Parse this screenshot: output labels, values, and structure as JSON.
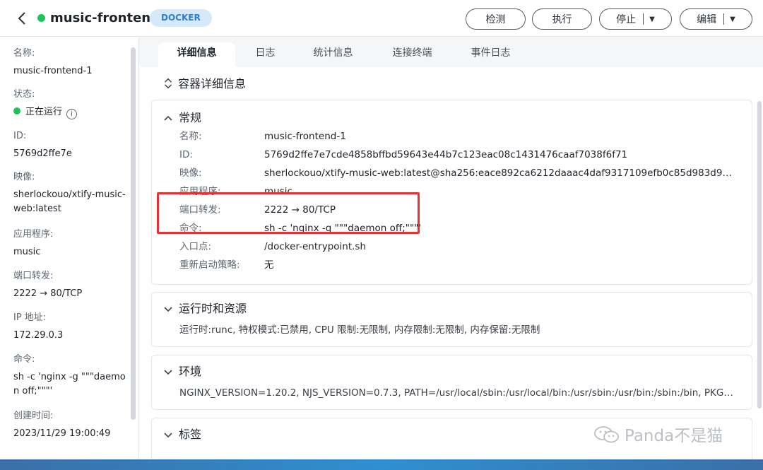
{
  "header": {
    "title": "music-frontend-1",
    "badge": "DOCKER",
    "buttons": {
      "detect": "检测",
      "execute": "执行",
      "stop": "停止",
      "edit": "编辑"
    },
    "status_color": "#1fc25a"
  },
  "sidebar": {
    "name_label": "名称:",
    "name_value": "music-frontend-1",
    "status_label": "状态:",
    "status_value": "正在运行",
    "id_label": "ID:",
    "id_value": "5769d2ffe7e",
    "image_label": "映像:",
    "image_value": "sherlockouo/xtify-music-web:latest",
    "app_label": "应用程序:",
    "app_value": "music",
    "port_label": "端口转发:",
    "port_value": "2222 → 80/TCP",
    "ip_label": "IP 地址:",
    "ip_value": "172.29.0.3",
    "cmd_label": "命令:",
    "cmd_value": "sh -c 'nginx -g \"\"\"daemon off;\"\"\"'",
    "created_label": "创建时间:",
    "created_value": "2023/11/29 19:00:49"
  },
  "tabs": [
    "详细信息",
    "日志",
    "统计信息",
    "连接终端",
    "事件日志"
  ],
  "section_title": "容器详细信息",
  "general": {
    "title": "常规",
    "rows": [
      {
        "k": "名称:",
        "v": "music-frontend-1"
      },
      {
        "k": "ID:",
        "v": "5769d2ffe7e7cde4858bffbd59643e44b7c123eac08c1431476caaf7038f6f71"
      },
      {
        "k": "映像:",
        "v": "sherlockouo/xtify-music-web:latest@sha256:eace892ca6212daaac4daf9317109efb0c85d983d914a..."
      },
      {
        "k": "应用程序:",
        "v": "music"
      },
      {
        "k": "端口转发:",
        "v": "2222 → 80/TCP"
      },
      {
        "k": "命令:",
        "v": "sh -c 'nginx -g \"\"\"daemon off;\"\"\"'"
      },
      {
        "k": "入口点:",
        "v": "/docker-entrypoint.sh"
      },
      {
        "k": "重新启动策略:",
        "v": "无"
      }
    ]
  },
  "runtime": {
    "title": "运行时和资源",
    "text": "运行时:runc, 特权模式:已禁用, CPU 限制:无限制, 内存限制:无限制, 内存保留:无限制"
  },
  "env": {
    "title": "环境",
    "text": "NGINX_VERSION=1.20.2, NJS_VERSION=0.7.3, PATH=/usr/local/sbin:/usr/local/bin:/usr/sbin:/usr/bin:/sbin:/bin, PKG_..."
  },
  "labels": {
    "title": "标签"
  },
  "watermark": "Panda不是猫"
}
